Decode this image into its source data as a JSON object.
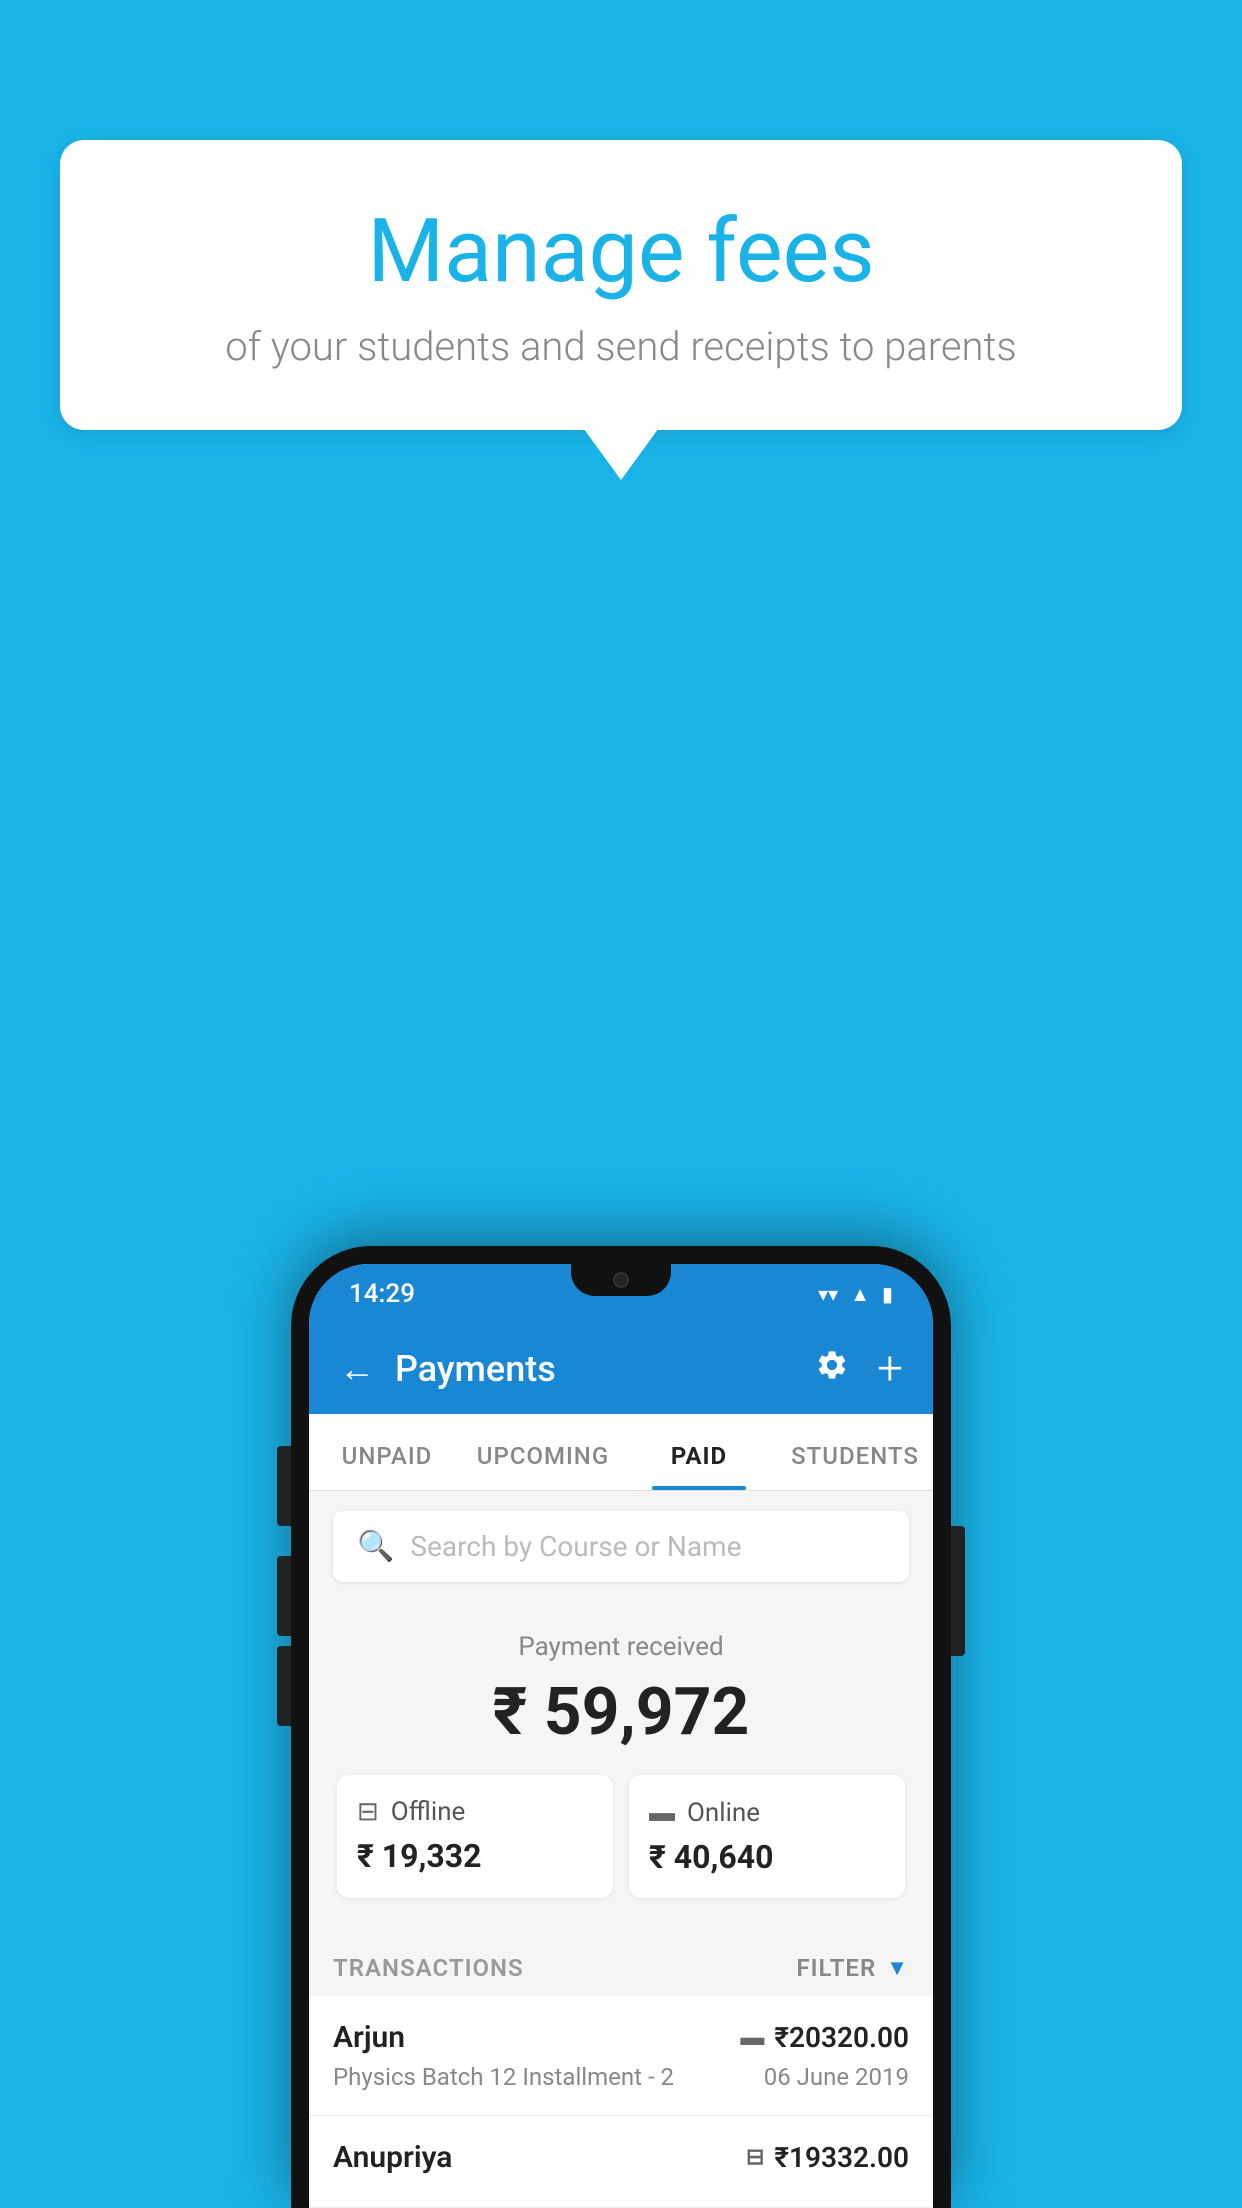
{
  "background_color": "#1ab3e8",
  "speech_bubble": {
    "title": "Manage fees",
    "subtitle": "of your students and send receipts to parents"
  },
  "phone": {
    "status_bar": {
      "time": "14:29",
      "wifi_icon": "wifi",
      "signal_icon": "signal",
      "battery_icon": "battery"
    },
    "header": {
      "back_label": "←",
      "title": "Payments",
      "gear_icon": "gear",
      "plus_icon": "+"
    },
    "tabs": [
      {
        "label": "UNPAID",
        "active": false
      },
      {
        "label": "UPCOMING",
        "active": false
      },
      {
        "label": "PAID",
        "active": true
      },
      {
        "label": "STUDENTS",
        "active": false
      }
    ],
    "search": {
      "placeholder": "Search by Course or Name"
    },
    "payment_summary": {
      "received_label": "Payment received",
      "total_amount": "₹ 59,972",
      "offline": {
        "label": "Offline",
        "amount": "₹ 19,332"
      },
      "online": {
        "label": "Online",
        "amount": "₹ 40,640"
      }
    },
    "transactions": {
      "section_label": "TRANSACTIONS",
      "filter_label": "FILTER",
      "items": [
        {
          "name": "Arjun",
          "detail": "Physics Batch 12 Installment - 2",
          "amount": "₹20320.00",
          "date": "06 June 2019",
          "payment_type": "card"
        },
        {
          "name": "Anupriya",
          "detail": "",
          "amount": "₹19332.00",
          "date": "",
          "payment_type": "offline"
        }
      ]
    }
  }
}
